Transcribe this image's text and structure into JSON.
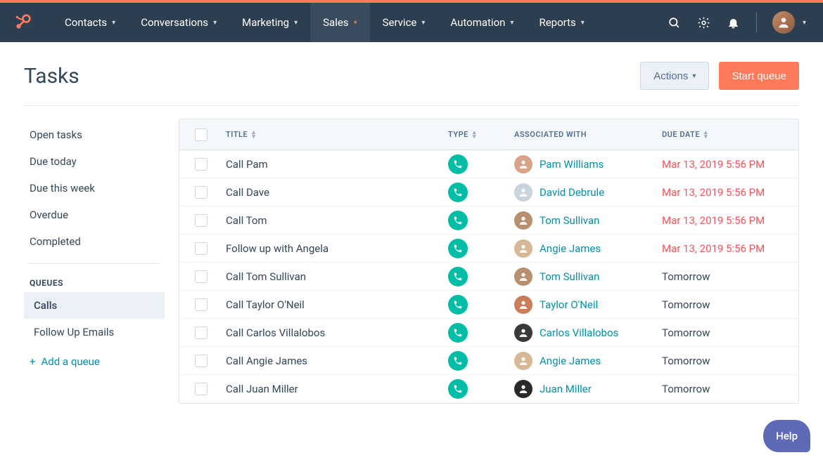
{
  "nav": {
    "items": [
      {
        "label": "Contacts"
      },
      {
        "label": "Conversations"
      },
      {
        "label": "Marketing"
      },
      {
        "label": "Sales",
        "active": true
      },
      {
        "label": "Service"
      },
      {
        "label": "Automation"
      },
      {
        "label": "Reports"
      }
    ]
  },
  "page": {
    "title": "Tasks",
    "actions_label": "Actions",
    "start_queue_label": "Start queue"
  },
  "sidebar": {
    "filters": [
      "Open tasks",
      "Due today",
      "Due this week",
      "Overdue",
      "Completed"
    ],
    "queues_heading": "QUEUES",
    "queues": [
      {
        "label": "Calls",
        "active": true
      },
      {
        "label": "Follow Up Emails",
        "active": false
      }
    ],
    "add_queue": "Add a queue"
  },
  "table": {
    "columns": {
      "title": "TITLE",
      "type": "TYPE",
      "assoc": "ASSOCIATED WITH",
      "due": "DUE DATE"
    },
    "rows": [
      {
        "title": "Call Pam",
        "person": "Pam Williams",
        "avatar": "#d9a28a",
        "due": "Mar 13, 2019 5:56 PM",
        "overdue": true
      },
      {
        "title": "Call Dave",
        "person": "David Debrule",
        "avatar": "#c9d4dc",
        "due": "Mar 13, 2019 5:56 PM",
        "overdue": true
      },
      {
        "title": "Call Tom",
        "person": "Tom Sullivan",
        "avatar": "#b89070",
        "due": "Mar 13, 2019 5:56 PM",
        "overdue": true
      },
      {
        "title": "Follow up with Angela",
        "person": "Angie James",
        "avatar": "#d6b896",
        "due": "Mar 13, 2019 5:56 PM",
        "overdue": true
      },
      {
        "title": "Call Tom Sullivan",
        "person": "Tom Sullivan",
        "avatar": "#b89070",
        "due": "Tomorrow",
        "overdue": false
      },
      {
        "title": "Call Taylor O'Neil",
        "person": "Taylor O'Neil",
        "avatar": "#c97d5a",
        "due": "Tomorrow",
        "overdue": false
      },
      {
        "title": "Call Carlos Villalobos",
        "person": "Carlos Villalobos",
        "avatar": "#3a3a3a",
        "due": "Tomorrow",
        "overdue": false
      },
      {
        "title": "Call Angie James",
        "person": "Angie James",
        "avatar": "#d6b896",
        "due": "Tomorrow",
        "overdue": false
      },
      {
        "title": "Call Juan Miller",
        "person": "Juan Miller",
        "avatar": "#2a2a2a",
        "due": "Tomorrow",
        "overdue": false
      }
    ]
  },
  "help_label": "Help"
}
